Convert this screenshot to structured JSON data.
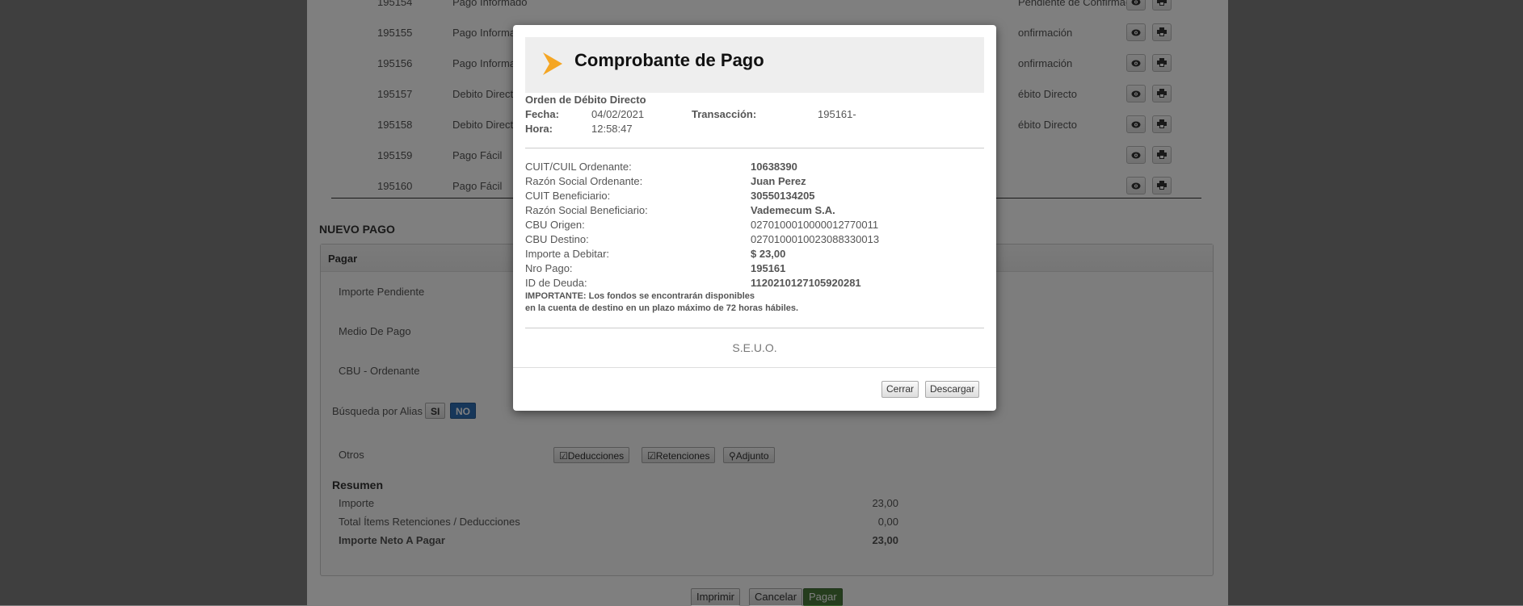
{
  "background": {
    "rows": [
      {
        "num": "195154",
        "tipo": "Pago Informado",
        "estado": "Pendiente de Confirmación"
      },
      {
        "num": "195155",
        "tipo": "Pago Informado",
        "estado": "onfirmación"
      },
      {
        "num": "195156",
        "tipo": "Pago Informado",
        "estado": "onfirmación"
      },
      {
        "num": "195157",
        "tipo": "Debito Directo",
        "estado": "ébito Directo"
      },
      {
        "num": "195158",
        "tipo": "Debito Directo",
        "estado": "ébito Directo"
      },
      {
        "num": "195159",
        "tipo": "Pago Fácil",
        "estado": ""
      },
      {
        "num": "195160",
        "tipo": "Pago Fácil",
        "estado": ""
      }
    ],
    "nuevo_pago": {
      "title": "NUEVO PAGO",
      "panel_title": "Pagar",
      "importe_pendiente": "Importe Pendiente",
      "medio_de_pago": "Medio De Pago",
      "cbu_ordenante": "CBU - Ordenante",
      "busqueda_alias": "Búsqueda por Alias",
      "si": "SI",
      "no": "NO",
      "otros": "Otros",
      "deducciones": "Deducciones",
      "retenciones": "Retenciones",
      "adjunto": "Adjunto",
      "resumen": "Resumen",
      "importe_label": "Importe",
      "importe_value": "23,00",
      "total_items_label": "Total Ítems Retenciones / Deducciones",
      "total_items_value": "0,00",
      "neto_label": "Importe Neto A Pagar",
      "neto_value": "23,00"
    },
    "actions": {
      "imprimir": "Imprimir",
      "cancelar": "Cancelar",
      "pagar": "Pagar"
    }
  },
  "modal": {
    "title": "Comprobante de Pago",
    "subtitle": "Orden de Débito Directo",
    "fecha_label": "Fecha:",
    "fecha_value": "04/02/2021",
    "hora_label": "Hora:",
    "hora_value": "12:58:47",
    "transaccion_label": "Transacción:",
    "transaccion_value": "195161-",
    "fields": [
      {
        "label": "CUIT/CUIL Ordenante:",
        "value": "10638390",
        "bold": true
      },
      {
        "label": "Razón Social Ordenante:",
        "value": "Juan Perez",
        "bold": true
      },
      {
        "label": "CUIT Beneficiario:",
        "value": "30550134205",
        "bold": true
      },
      {
        "label": "Razón Social Beneficiario:",
        "value": "Vademecum S.A.",
        "bold": true
      },
      {
        "label": "CBU Origen:",
        "value": "0270100010000012770011",
        "bold": false
      },
      {
        "label": "CBU Destino:",
        "value": "0270100010023088330013",
        "bold": false
      },
      {
        "label": "Importe a Debitar:",
        "value": "$ 23,00",
        "bold": true
      },
      {
        "label": "Nro Pago:",
        "value": "195161",
        "bold": true
      },
      {
        "label": "ID de Deuda:",
        "value": "1120210127105920281",
        "bold": true
      }
    ],
    "importante_line1": "IMPORTANTE: Los fondos se encontrarán disponibles",
    "importante_line2": "en la cuenta de destino en un plazo máximo de 72 horas hábiles.",
    "seuo": "S.E.U.O.",
    "cerrar": "Cerrar",
    "descargar": "Descargar"
  },
  "colors": {
    "accent": "#f5a623",
    "pagar_bg": "#4a7a3a",
    "no_bg": "#2f6fb4"
  }
}
